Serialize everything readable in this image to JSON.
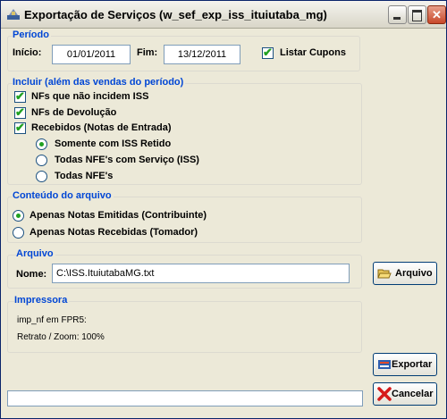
{
  "window": {
    "title": "Exportação de Serviços (w_sef_exp_iss_ituiutaba_mg)"
  },
  "periodo": {
    "title": "Período",
    "inicio_label": "Início:",
    "inicio_value": "01/01/2011",
    "fim_label": "Fim:",
    "fim_value": "13/12/2011",
    "listar_cupons_label": "Listar Cupons",
    "listar_cupons_checked": true
  },
  "incluir": {
    "title": "Incluir (além das vendas do período)",
    "nfs_nao_incidem_label": "NFs que não incidem ISS",
    "nfs_devolucao_label": "NFs de Devolução",
    "recebidos_label": "Recebidos (Notas de Entrada)",
    "radio_somente_label": "Somente com ISS Retido",
    "radio_todas_servico_label": "Todas NFE's com Serviço (ISS)",
    "radio_todas_label": "Todas NFE's",
    "selected_radio": "Somente com ISS Retido"
  },
  "conteudo": {
    "title": "Conteúdo do arquivo",
    "emitidas_label": "Apenas Notas Emitidas (Contribuinte)",
    "recebidas_label": "Apenas Notas Recebidas (Tomador)",
    "selected": "Apenas Notas Emitidas (Contribuinte)"
  },
  "arquivo": {
    "title": "Arquivo",
    "nome_label": "Nome:",
    "nome_value": "C:\\ISS.ItuiutabaMG.txt",
    "button_label": "Arquivo"
  },
  "impressora": {
    "title": "Impressora",
    "line1": "imp_nf em FPR5:",
    "line2": "Retrato / Zoom: 100%"
  },
  "buttons": {
    "exportar_label": "Exportar",
    "cancelar_label": "Cancelar"
  },
  "colors": {
    "group_title": "#0046d5",
    "check_mark": "#21a121",
    "window_bg": "#ece9d8"
  }
}
